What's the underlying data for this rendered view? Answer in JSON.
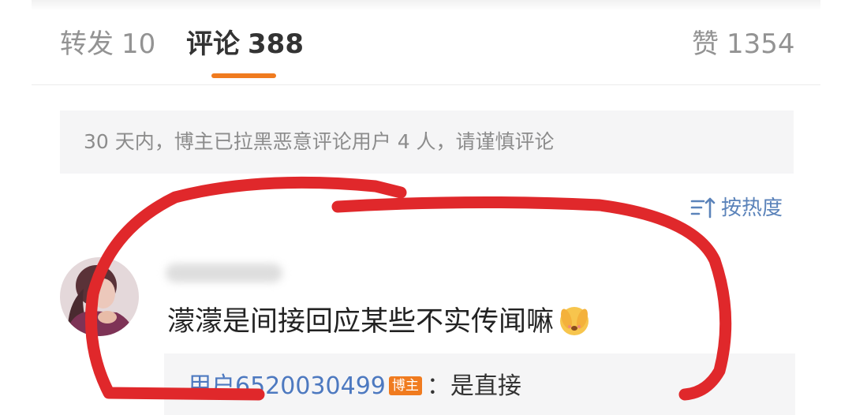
{
  "tabs": {
    "repost": {
      "label": "转发",
      "count": "10"
    },
    "comments": {
      "label": "评论",
      "count": "388"
    },
    "likes": {
      "label": "赞",
      "count": "1354"
    }
  },
  "notice": {
    "text": "30 天内，博主已拉黑恶意评论用户 4 人，请谨慎评论"
  },
  "sort": {
    "label": "按热度",
    "icon": "sort-icon"
  },
  "comment": {
    "text": "濛濛是间接回应某些不实传闻嘛",
    "emoji": "embarrassed-face-emoji",
    "avatar_icon": "avatar"
  },
  "reply": {
    "user": "用户6520030499",
    "badge": "博主",
    "text": "：是直接"
  },
  "colors": {
    "accent": "#f07b1f",
    "link": "#4d79c0",
    "sort_blue": "#5b83ba",
    "badge": "#f07b1f",
    "annotation_red": "#e0282b"
  }
}
